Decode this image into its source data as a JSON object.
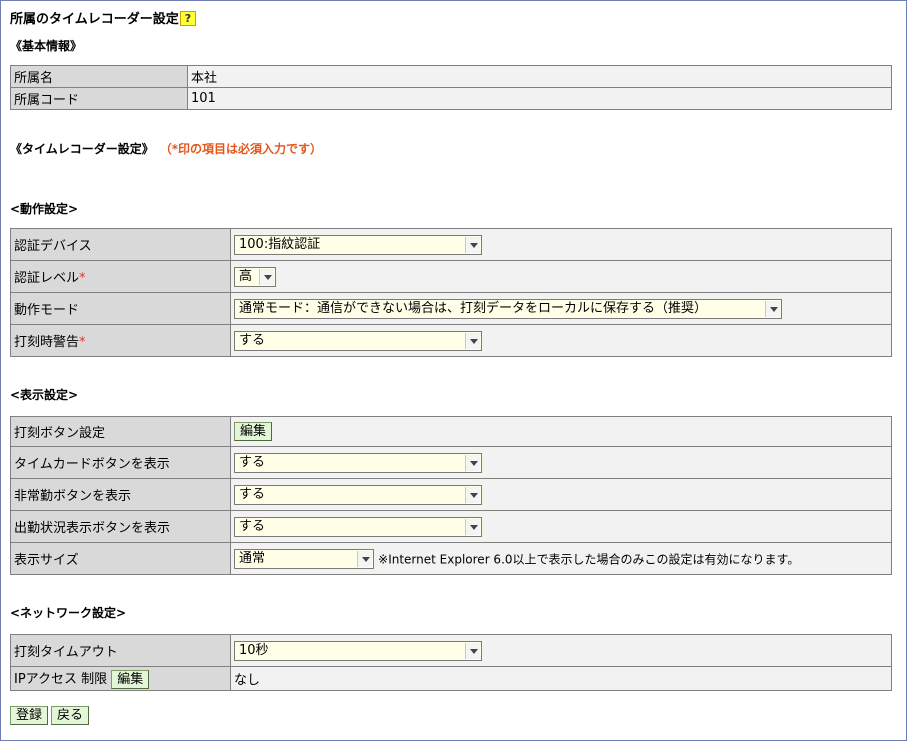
{
  "page": {
    "title": "所属のタイムレコーダー設定",
    "help_label": "?"
  },
  "basic": {
    "heading": "《基本情報》",
    "rows": [
      {
        "label": "所属名",
        "value": "本社"
      },
      {
        "label": "所属コード",
        "value": "101"
      }
    ]
  },
  "tr": {
    "heading": "《タイムレコーダー設定》",
    "required_note": "（*印の項目は必須入力です）"
  },
  "required_mark": "*",
  "operation": {
    "heading": "<動作設定>",
    "auth_device": {
      "label": "認証デバイス",
      "value": "100:指紋認証"
    },
    "auth_level": {
      "label": "認証レベル",
      "value": "高"
    },
    "mode": {
      "label": "動作モード",
      "value": "通常モード：通信ができない場合は、打刻データをローカルに保存する（推奨）"
    },
    "warning": {
      "label": "打刻時警告",
      "value": "する"
    }
  },
  "display": {
    "heading": "<表示設定>",
    "stamp_button": {
      "label": "打刻ボタン設定",
      "button": "編集"
    },
    "timecard": {
      "label": "タイムカードボタンを表示",
      "value": "する"
    },
    "emergency": {
      "label": "非常勤ボタンを表示",
      "value": "する"
    },
    "attendance": {
      "label": "出勤状況表示ボタンを表示",
      "value": "する"
    },
    "size": {
      "label": "表示サイズ",
      "value": "通常",
      "note": "※Internet Explorer 6.0以上で表示した場合のみこの設定は有効になります。"
    }
  },
  "network": {
    "heading": "<ネットワーク設定>",
    "timeout": {
      "label": "打刻タイムアウト",
      "value": "10秒"
    },
    "ip": {
      "label": "IPアクセス 制限",
      "button": "編集",
      "value": "なし"
    }
  },
  "footer": {
    "register": "登録",
    "back": "戻る"
  }
}
